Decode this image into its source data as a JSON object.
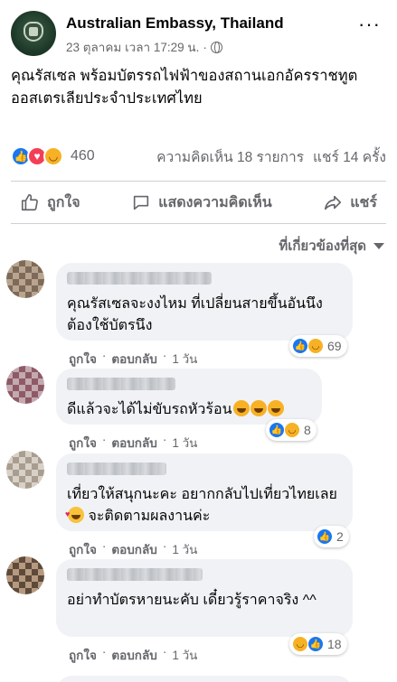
{
  "post": {
    "page_name": "Australian Embassy, Thailand",
    "timestamp": "23 ตุลาคม เวลา 17:29 น.",
    "separator": "·",
    "text": "คุณรัสเซล พร้อมบัตรรถไฟฟ้าของสถานเอกอัครราชทูตออสเตรเลียประจำประเทศไทย",
    "reaction_count": "460",
    "comments_count": "ความคิดเห็น 18 รายการ",
    "shares_count": "แชร์ 14 ครั้ง"
  },
  "actions": {
    "like": "ถูกใจ",
    "comment": "แสดงความคิดเห็น",
    "share": "แชร์"
  },
  "sort_label": "ที่เกี่ยวข้องที่สุด",
  "comment_actions": {
    "like": "ถูกใจ",
    "reply": "ตอบกลับ",
    "dot": "·",
    "time": "1 วัน"
  },
  "comments": [
    {
      "text": "คุณรัสเซลจะงงไหม ที่เปลี่ยนสายขึ้นอันนึง ต้องใช้บัตรนึง",
      "reactions": "69"
    },
    {
      "text": "ดีแล้วจะได้ไม่ขับรถหัวร้อน",
      "reactions": "8"
    },
    {
      "text": "เที่ยวให้สนุกนะคะ อยากกลับไปเที่ยวไทยเลย",
      "text_after": "จะติดตามผลงานค่ะ",
      "reactions": "2"
    },
    {
      "text": "อย่าทำบัตรหายนะคับ เดี๋ยวรู้ราคาจริง ^^",
      "reactions": "18"
    }
  ],
  "colors": {
    "like_blue": "#1877f2",
    "love_red": "#f33e58",
    "haha_yellow": "#f7b125",
    "secondary_text": "#65676b",
    "bubble_bg": "#f0f2f5"
  },
  "icons": [
    "globe-icon",
    "more-icon",
    "like-icon",
    "comment-icon",
    "share-icon",
    "caret-down-icon"
  ]
}
